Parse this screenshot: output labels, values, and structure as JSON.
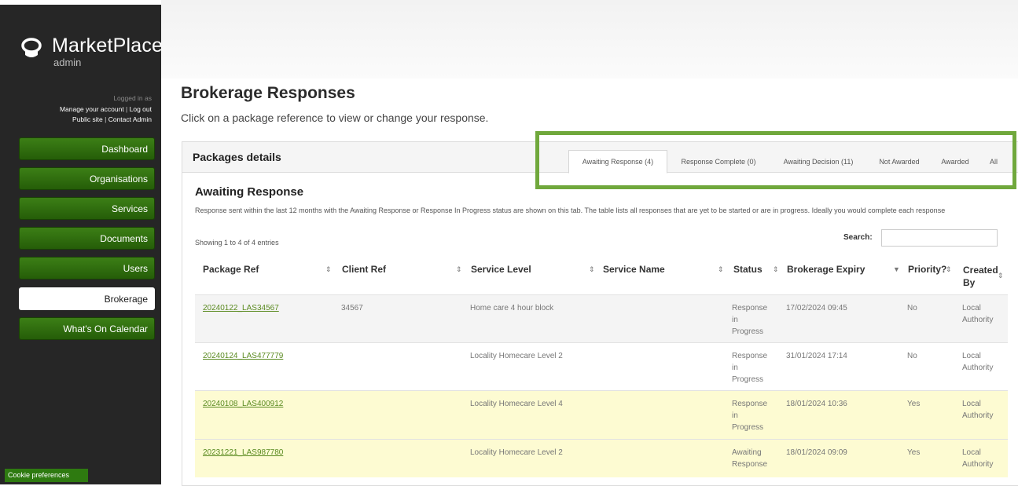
{
  "app": {
    "brand": "MarketPlace",
    "sub": "admin",
    "logged_in": "Logged in as",
    "account_links": {
      "manage": "Manage your account",
      "logout": "Log out",
      "public": "Public site",
      "contact": "Contact Admin"
    }
  },
  "nav": {
    "items": [
      "Dashboard",
      "Organisations",
      "Services",
      "Documents",
      "Users",
      "Brokerage",
      "What's On Calendar"
    ],
    "active": "Brokerage"
  },
  "cookie": "Cookie preferences",
  "page": {
    "title": "Brokerage Responses",
    "subtitle": "Click on a package reference to view or change your response."
  },
  "panel": {
    "title": "Packages details",
    "tabs": [
      "Awaiting Response (4)",
      "Response Complete (0)",
      "Awaiting Decision (11)",
      "Not Awarded",
      "Awarded",
      "All"
    ],
    "active_tab": "Awaiting Response (4)"
  },
  "section": {
    "title": "Awaiting Response",
    "description": "Response sent within the last 12 months with the Awaiting Response or Response In Progress status are shown on this tab. The table lists all responses that are yet to be started or are in progress. Ideally you would complete each response",
    "showing": "Showing 1 to 4 of 4 entries",
    "search_label": "Search:",
    "search_value": ""
  },
  "table": {
    "headers": [
      "Package Ref",
      "Client Ref",
      "Service Level",
      "Service Name",
      "Status",
      "Brokerage Expiry",
      "Priority?",
      "Created By"
    ],
    "rows": [
      {
        "package_ref": "20240122_LAS34567",
        "client_ref": "34567",
        "service_level": "Home care 4 hour block",
        "service_name": "",
        "status": "Response in Progress",
        "expiry": "17/02/2024 09:45",
        "priority": "No",
        "created_by": "Local Authority",
        "highlight": false
      },
      {
        "package_ref": "20240124_LAS477779",
        "client_ref": "",
        "service_level": "Locality Homecare Level 2",
        "service_name": "",
        "status": "Response in Progress",
        "expiry": "31/01/2024 17:14",
        "priority": "No",
        "created_by": "Local Authority",
        "highlight": false
      },
      {
        "package_ref": "20240108_LAS400912",
        "client_ref": "",
        "service_level": "Locality Homecare Level 4",
        "service_name": "",
        "status": "Response in Progress",
        "expiry": "18/01/2024 10:36",
        "priority": "Yes",
        "created_by": "Local Authority",
        "highlight": true
      },
      {
        "package_ref": "20231221_LAS987780",
        "client_ref": "",
        "service_level": "Locality Homecare Level 2",
        "service_name": "",
        "status": "Awaiting Response",
        "expiry": "18/01/2024 09:09",
        "priority": "Yes",
        "created_by": "Local Authority",
        "highlight": true
      }
    ]
  },
  "colors": {
    "nav_green": "#2f6e0f",
    "highlight_row": "#fdfbd2",
    "callout_border": "#70a83c",
    "link": "#5a8a20"
  }
}
